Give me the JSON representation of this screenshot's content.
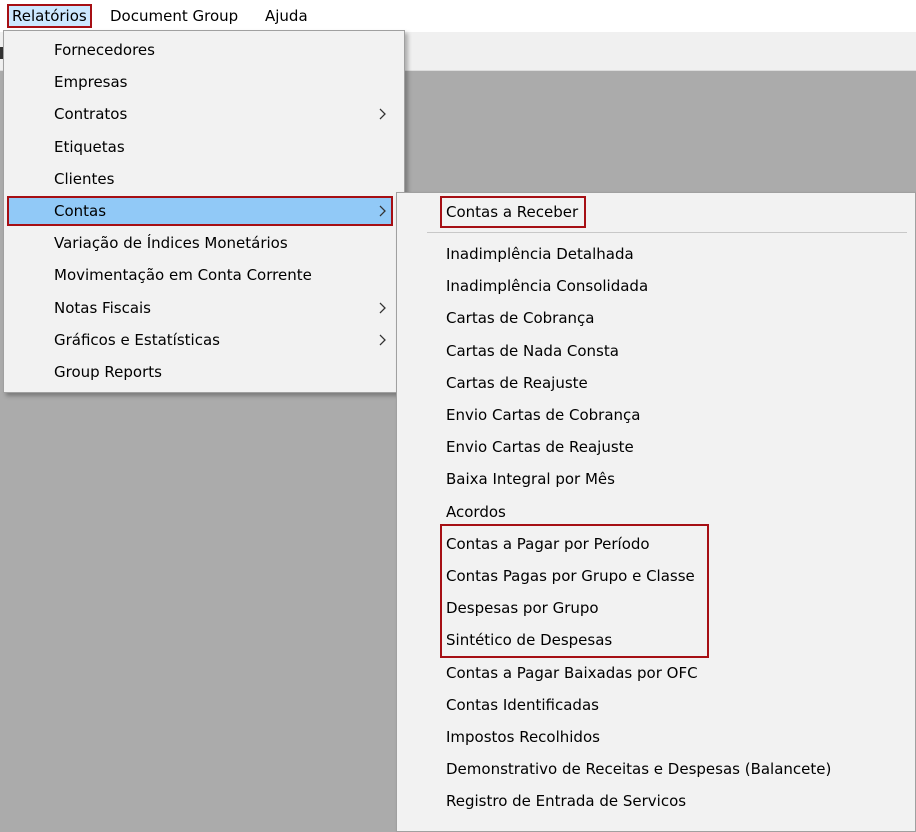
{
  "menubar": {
    "items": [
      {
        "label": "Relatórios"
      },
      {
        "label": "Document Group"
      },
      {
        "label": "Ajuda"
      }
    ]
  },
  "main_menu": {
    "items": [
      {
        "label": "Fornecedores",
        "has_submenu": false
      },
      {
        "label": "Empresas",
        "has_submenu": false
      },
      {
        "label": "Contratos",
        "has_submenu": true
      },
      {
        "label": "Etiquetas",
        "has_submenu": false
      },
      {
        "label": "Clientes",
        "has_submenu": false
      },
      {
        "label": "Contas",
        "has_submenu": true
      },
      {
        "label": "Variação de Índices Monetários",
        "has_submenu": false
      },
      {
        "label": "Movimentação em Conta Corrente",
        "has_submenu": false
      },
      {
        "label": "Notas Fiscais",
        "has_submenu": true
      },
      {
        "label": "Gráficos e Estatísticas",
        "has_submenu": true
      },
      {
        "label": "Group Reports",
        "has_submenu": false
      }
    ],
    "highlighted": "Contas"
  },
  "contas_submenu": {
    "items": [
      {
        "label": "Contas a Receber"
      },
      {
        "label": "Inadimplência Detalhada"
      },
      {
        "label": "Inadimplência Consolidada"
      },
      {
        "label": "Cartas de Cobrança"
      },
      {
        "label": "Cartas de Nada Consta"
      },
      {
        "label": "Cartas de Reajuste"
      },
      {
        "label": "Envio Cartas de Cobrança"
      },
      {
        "label": "Envio Cartas de Reajuste"
      },
      {
        "label": "Baixa Integral por Mês"
      },
      {
        "label": "Acordos"
      },
      {
        "label": "Contas a Pagar por Período"
      },
      {
        "label": "Contas Pagas por Grupo e Classe"
      },
      {
        "label": "Despesas por Grupo"
      },
      {
        "label": "Sintético de Despesas"
      },
      {
        "label": "Contas a Pagar Baixadas por OFC"
      },
      {
        "label": "Contas Identificadas"
      },
      {
        "label": "Impostos Recolhidos"
      },
      {
        "label": "Demonstrativo de Receitas e Despesas (Balancete)"
      },
      {
        "label": "Registro de Entrada de Servicos"
      }
    ]
  },
  "colors": {
    "highlight": "#91c9f7",
    "annotation": "#a60f14",
    "menu_bg": "#f2f2f2",
    "workspace": "#ababab"
  }
}
